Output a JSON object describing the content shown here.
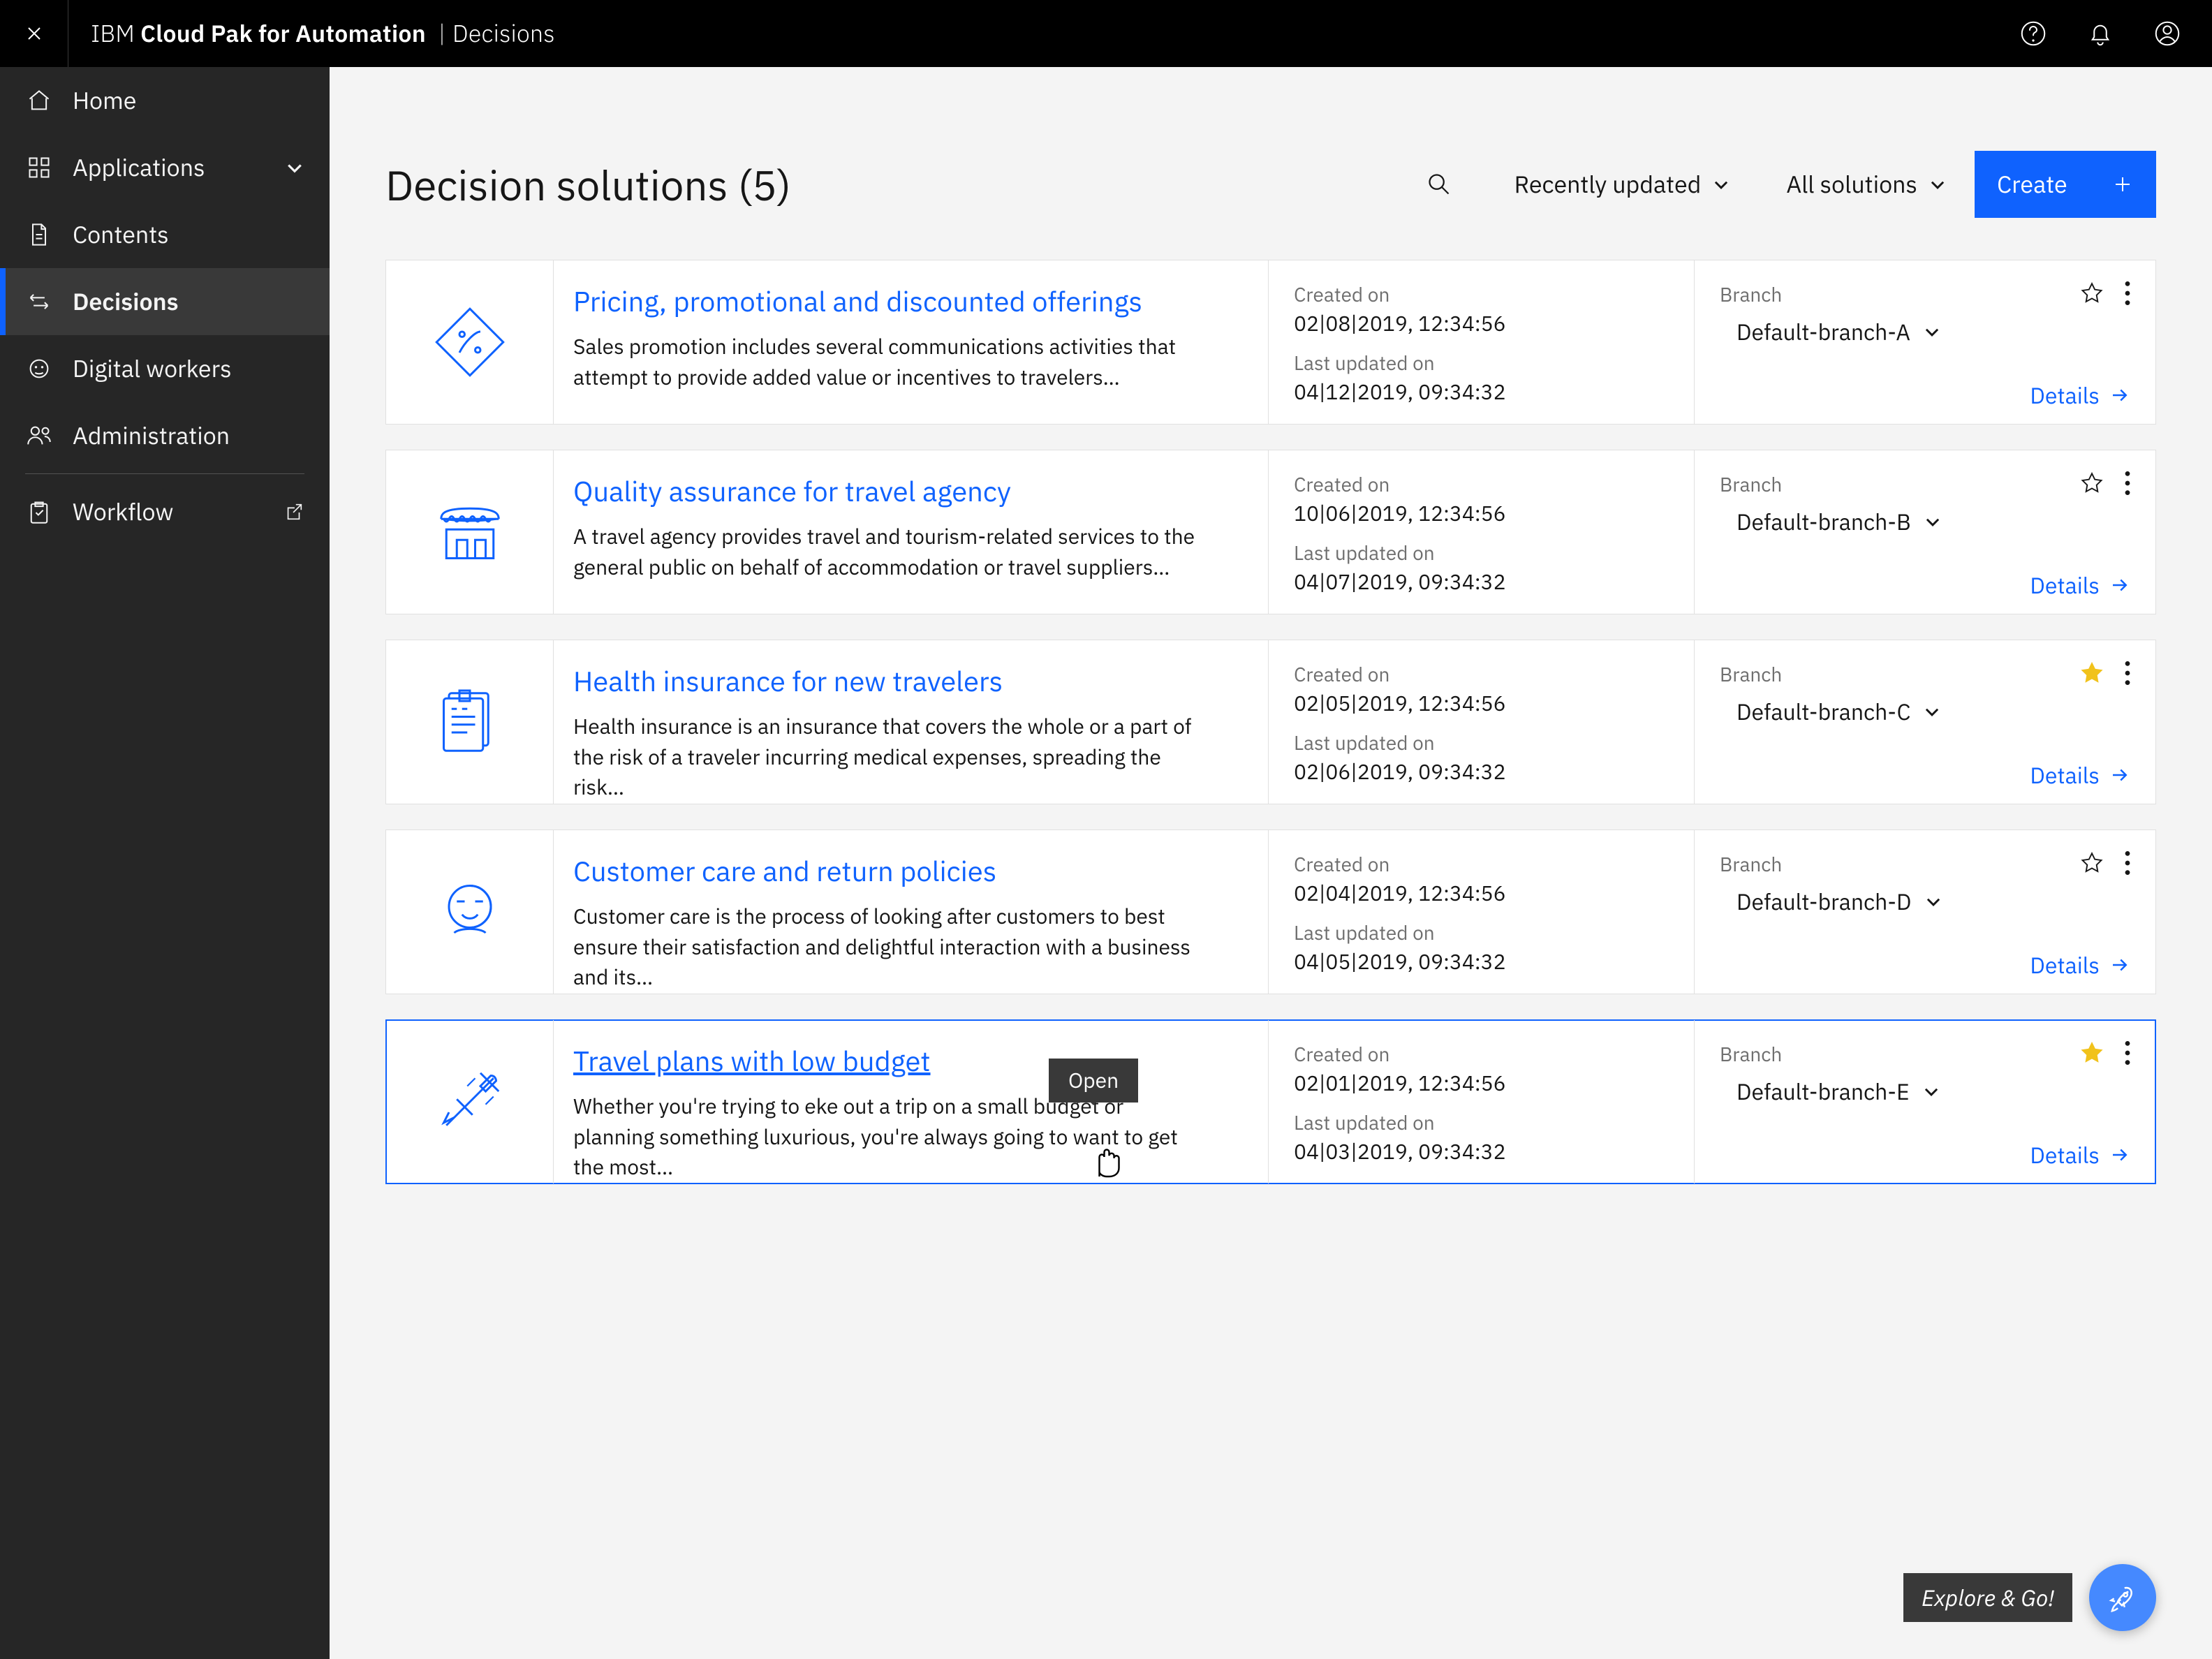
{
  "topbar": {
    "brand_prefix": "IBM",
    "brand_main": "Cloud Pak for Automation",
    "brand_suffix": "Decisions"
  },
  "nav": {
    "items": [
      {
        "label": "Home"
      },
      {
        "label": "Applications"
      },
      {
        "label": "Contents"
      },
      {
        "label": "Decisions"
      },
      {
        "label": "Digital workers"
      },
      {
        "label": "Administration"
      },
      {
        "label": "Workflow"
      }
    ]
  },
  "page": {
    "title": "Decision solutions (5)",
    "sort_label": "Recently updated",
    "filter_label": "All solutions",
    "create_label": "Create",
    "explore_label": "Explore & Go!",
    "tooltip_open": "Open"
  },
  "labels": {
    "created": "Created on",
    "updated": "Last updated on",
    "branch": "Branch",
    "details": "Details"
  },
  "solutions": [
    {
      "title": "Pricing, promotional and discounted offerings",
      "desc": "Sales promotion includes several communications activities that attempt to provide added value or incentives to travelers…",
      "created": "02|08|2019, 12:34:56",
      "updated": "04|12|2019, 09:34:32",
      "branch": "Default-branch-A",
      "fav": false
    },
    {
      "title": "Quality assurance for travel agency",
      "desc": "A travel agency provides travel and tourism-related services to the general public on behalf of accommodation or travel suppliers…",
      "created": "10|06|2019, 12:34:56",
      "updated": "04|07|2019, 09:34:32",
      "branch": "Default-branch-B",
      "fav": false
    },
    {
      "title": "Health insurance for new travelers",
      "desc": "Health insurance is an insurance that covers the whole or a part of the risk of a traveler incurring medical expenses, spreading the risk…",
      "created": "02|05|2019, 12:34:56",
      "updated": "02|06|2019, 09:34:32",
      "branch": "Default-branch-C",
      "fav": true
    },
    {
      "title": "Customer care and return policies",
      "desc": "Customer care is the process of looking after customers to best ensure their satisfaction and delightful interaction with a business and its…",
      "created": "02|04|2019, 12:34:56",
      "updated": "04|05|2019, 09:34:32",
      "branch": "Default-branch-D",
      "fav": false
    },
    {
      "title": "Travel plans with low budget",
      "desc": "Whether you're trying to eke out a trip on a small budget or planning something luxurious, you're always going to want to get the most…",
      "created": "02|01|2019, 12:34:56",
      "updated": "04|03|2019, 09:34:32",
      "branch": "Default-branch-E",
      "fav": true
    }
  ]
}
